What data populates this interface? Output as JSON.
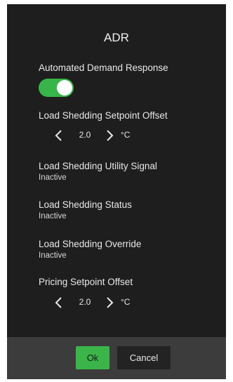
{
  "dialog": {
    "title": "ADR"
  },
  "adr": {
    "label": "Automated Demand Response",
    "enabled": true,
    "accent_color": "#38b54a"
  },
  "load_shedding_offset": {
    "label": "Load Shedding Setpoint Offset",
    "value": "2.0",
    "unit": "°C",
    "decrease_icon": "chevron-left-icon",
    "increase_icon": "chevron-right-icon"
  },
  "utility_signal": {
    "label": "Load Shedding Utility Signal",
    "value": "Inactive"
  },
  "shedding_status": {
    "label": "Load Shedding Status",
    "value": "Inactive"
  },
  "shedding_override": {
    "label": "Load Shedding Override",
    "value": "Inactive"
  },
  "pricing_offset": {
    "label": "Pricing Setpoint Offset",
    "value": "2.0",
    "unit": "°C",
    "decrease_icon": "chevron-left-icon",
    "increase_icon": "chevron-right-icon"
  },
  "footer": {
    "ok_label": "Ok",
    "cancel_label": "Cancel",
    "ok_color": "#3bb54a"
  }
}
